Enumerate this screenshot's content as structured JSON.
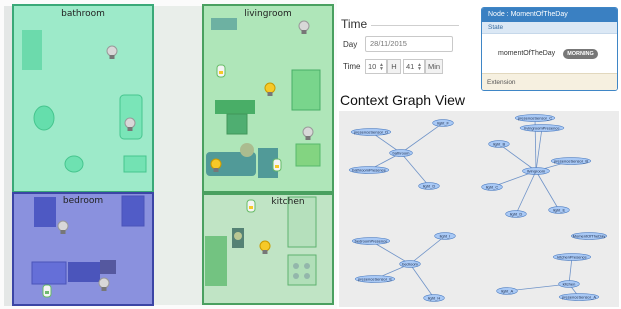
{
  "floorplan": {
    "rooms": {
      "bathroom": "bathroom",
      "livingroom": "livingroom",
      "bedroom": "bedroom",
      "kitchen": "kitchen"
    }
  },
  "time": {
    "title": "Time",
    "day_label": "Day",
    "date_value": "28/11/2015",
    "time_label": "Time",
    "hour_value": "10",
    "hour_unit": "H",
    "minute_value": "41",
    "minute_unit": "Min"
  },
  "node_panel": {
    "header": "Node : MomentOfTheDay",
    "state_label": "State",
    "key": "momentOfTheDay",
    "value": "MORNING",
    "extension_label": "Extension"
  },
  "graph": {
    "title": "Context Graph View",
    "clusters": [
      {
        "center": "bathroom",
        "nodes": [
          "presenceSensor_D",
          "light_F",
          "bathroomPresence",
          "light_D"
        ]
      },
      {
        "center": "livingroom",
        "nodes": [
          "presenceSensor_C",
          "livingroomPresence",
          "light_B",
          "presenceSensor_B",
          "light_C",
          "light_D",
          "light_E"
        ]
      },
      {
        "center": "bedroom",
        "nodes": [
          "bedroomPresence",
          "light_I",
          "presenceSensor_E",
          "light_H"
        ]
      },
      {
        "center": "kitchen",
        "nodes": [
          "kitchenPresence",
          "light_A",
          "presenceSensor_A"
        ]
      }
    ],
    "standalone": [
      "MomentOfTheDay"
    ]
  },
  "colors": {
    "bathroom": "#5fd9a4",
    "livingroom": "#7fd38b",
    "bedroom": "#5a63c9",
    "kitchen": "#8fd19a",
    "panel_header": "#3a80c2",
    "graph_node": "#a9c9f5"
  }
}
